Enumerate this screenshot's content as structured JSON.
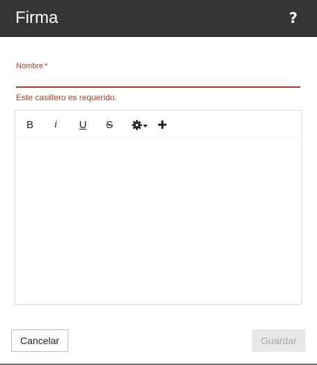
{
  "dialog": {
    "title": "Firma",
    "help_label": "?"
  },
  "form": {
    "name_field": {
      "label": "Nombre",
      "required_mark": "*",
      "value": "",
      "error": "Este casillero es requerido."
    }
  },
  "editor": {
    "toolbar": {
      "bold_label": "B",
      "italic_label": "i",
      "underline_label": "U",
      "strike_label": "S",
      "settings_icon": "gear-icon",
      "add_icon": "plus-icon"
    },
    "content": ""
  },
  "actions": {
    "cancel_label": "Cancelar",
    "save_label": "Guardar"
  },
  "colors": {
    "header_bg": "#353535",
    "error": "#b23a1b",
    "disabled_bg": "#e8e8e8",
    "disabled_text": "#a8a8a8"
  }
}
